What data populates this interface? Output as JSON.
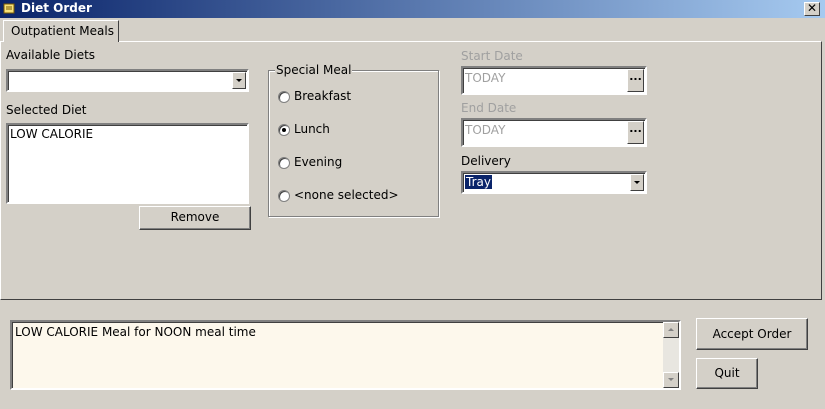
{
  "window": {
    "title": "Diet Order",
    "close_label": "✕"
  },
  "tabs": [
    {
      "label": "Outpatient Meals"
    }
  ],
  "available_diets": {
    "label": "Available Diets",
    "value": ""
  },
  "selected_diet": {
    "label": "Selected Diet",
    "items": [
      "LOW CALORIE"
    ]
  },
  "remove_button": {
    "label": "Remove"
  },
  "special_meal": {
    "title": "Special Meal",
    "options": [
      {
        "label": "Breakfast",
        "checked": false
      },
      {
        "label": "Lunch",
        "checked": true
      },
      {
        "label": "Evening",
        "checked": false
      },
      {
        "label": "<none selected>",
        "checked": false
      }
    ]
  },
  "start_date": {
    "label": "Start Date",
    "value": "TODAY",
    "button": "..."
  },
  "end_date": {
    "label": "End Date",
    "value": "TODAY",
    "button": "..."
  },
  "delivery": {
    "label": "Delivery",
    "value": "Tray"
  },
  "summary": {
    "text": "LOW CALORIE Meal for NOON meal time"
  },
  "accept_button": {
    "label": "Accept Order"
  },
  "quit_button": {
    "label": "Quit"
  },
  "colors": {
    "title_start": "#0a246a",
    "title_end": "#a6caf0",
    "selection": "#0a246a",
    "memo_bg": "#fdf8ec"
  }
}
